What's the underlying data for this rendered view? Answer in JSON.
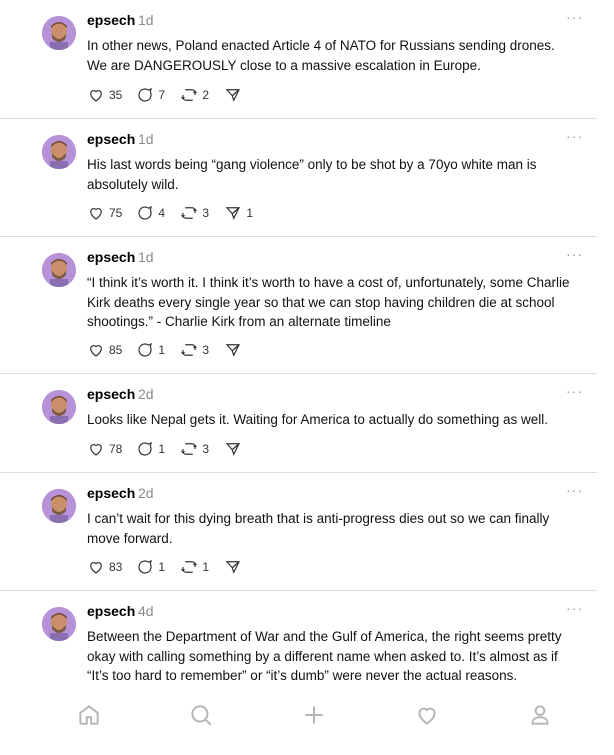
{
  "posts": [
    {
      "user": "epsech",
      "time": "1d",
      "text": "In other news, Poland enacted Article 4 of NATO for Russians sending drones. We are DANGEROUSLY close to a massive escalation in Europe.",
      "likes": "35",
      "replies": "7",
      "reposts": "2",
      "shares": ""
    },
    {
      "user": "epsech",
      "time": "1d",
      "text": "His last words being “gang violence” only to be shot by a 70yo white man is absolutely wild.",
      "likes": "75",
      "replies": "4",
      "reposts": "3",
      "shares": "1"
    },
    {
      "user": "epsech",
      "time": "1d",
      "text": "“I think it’s worth it. I think it’s worth to have a cost of, unfortunately, some Charlie Kirk deaths every single year so that we can stop having children die at school shootings.” - Charlie Kirk from an alternate timeline",
      "likes": "85",
      "replies": "1",
      "reposts": "3",
      "shares": ""
    },
    {
      "user": "epsech",
      "time": "2d",
      "text": "Looks like Nepal gets it. Waiting for America to actually do something as well.",
      "likes": "78",
      "replies": "1",
      "reposts": "3",
      "shares": ""
    },
    {
      "user": "epsech",
      "time": "2d",
      "text": "I can’t wait for this dying breath that is anti-progress dies out so we can finally move forward.",
      "likes": "83",
      "replies": "1",
      "reposts": "1",
      "shares": ""
    },
    {
      "user": "epsech",
      "time": "4d",
      "text": "Between the Department of War and the Gulf of America, the right seems pretty okay with calling something by a different name when asked to. It’s almost as if “It’s too hard to remember” or “it’s dumb” were never the actual reasons.",
      "likes": "",
      "replies": "",
      "reposts": "",
      "shares": ""
    }
  ],
  "more_label": "···",
  "tabs": [
    "home-icon",
    "search-icon",
    "compose-icon",
    "activity-icon",
    "profile-icon"
  ]
}
